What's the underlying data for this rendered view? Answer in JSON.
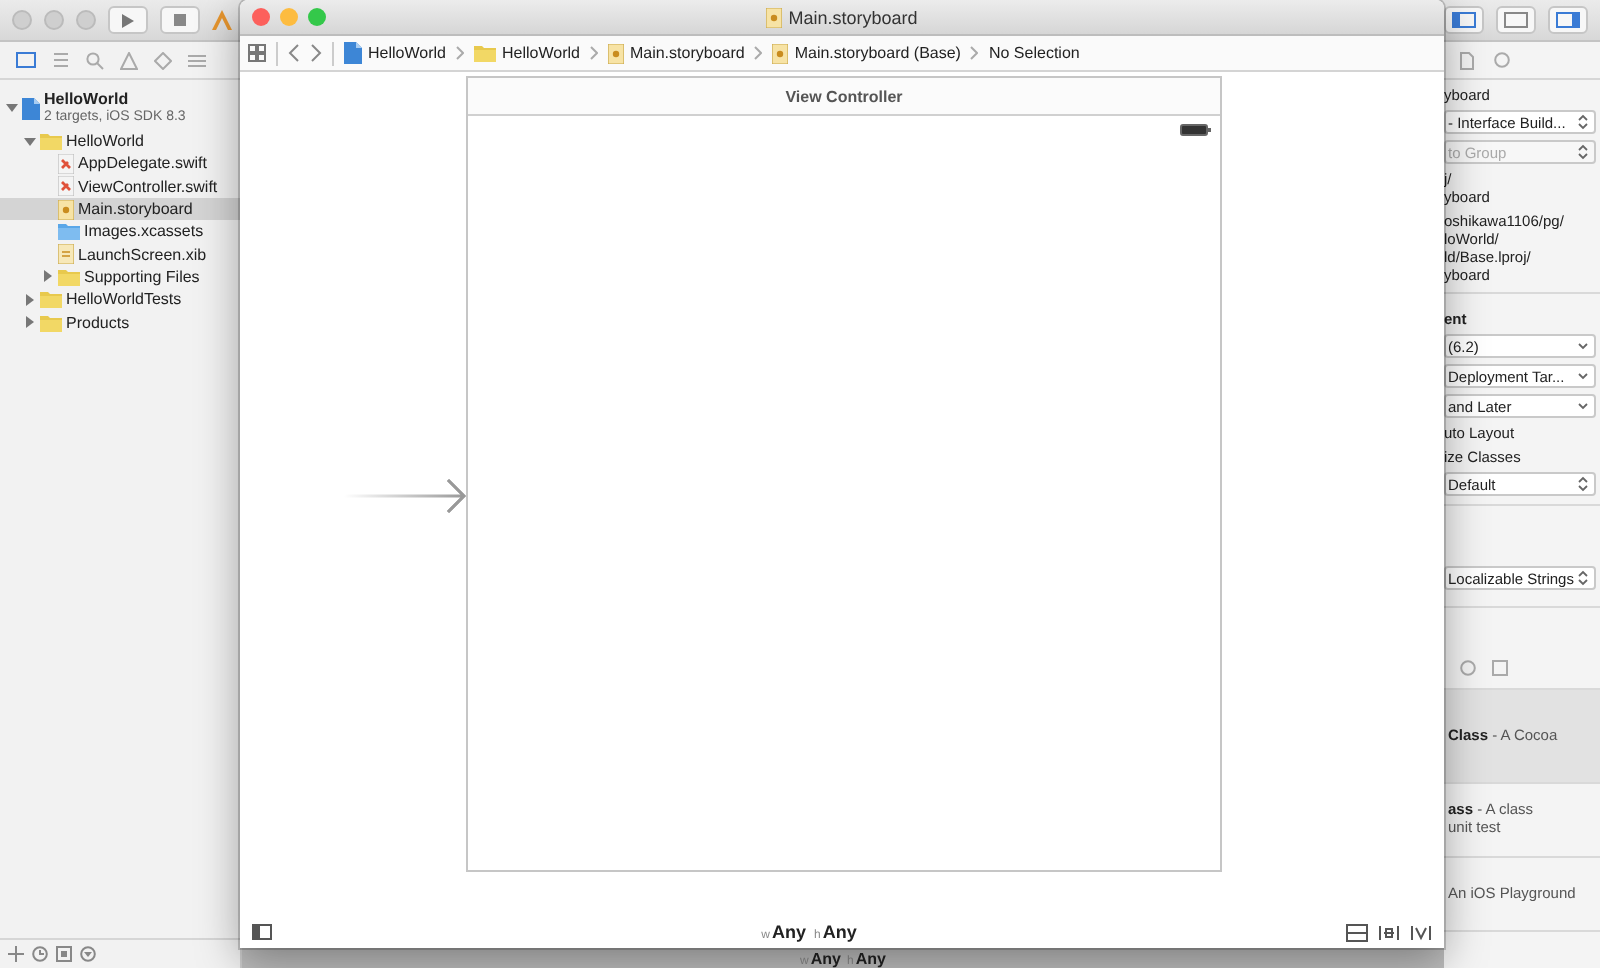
{
  "xcode": {
    "navigator": {
      "tree": [
        {
          "label": "HelloWorld",
          "subtitle": "2 targets, iOS SDK 8.3",
          "kind": "project",
          "expanded": true,
          "selected": false,
          "children": [
            {
              "label": "HelloWorld",
              "kind": "folder",
              "expanded": true,
              "selected": false,
              "children": [
                {
                  "label": "AppDelegate.swift",
                  "kind": "swift",
                  "selected": false
                },
                {
                  "label": "ViewController.swift",
                  "kind": "swift",
                  "selected": false
                },
                {
                  "label": "Main.storyboard",
                  "kind": "storyboard",
                  "selected": true
                },
                {
                  "label": "Images.xcassets",
                  "kind": "assets",
                  "selected": false
                },
                {
                  "label": "LaunchScreen.xib",
                  "kind": "xib",
                  "selected": false
                },
                {
                  "label": "Supporting Files",
                  "kind": "folder",
                  "expanded": false,
                  "selected": false
                }
              ]
            },
            {
              "label": "HelloWorldTests",
              "kind": "folder",
              "expanded": false,
              "selected": false
            },
            {
              "label": "Products",
              "kind": "folder",
              "expanded": false,
              "selected": false
            }
          ]
        }
      ]
    },
    "inspector": {
      "identity": {
        "name_tail": "yboard",
        "type": {
          "value": "- Interface Build...",
          "kind": "popup",
          "disabled": false
        },
        "location": {
          "value": "to Group",
          "kind": "popup",
          "disabled": true
        },
        "path_lines": [
          "j/",
          "yboard"
        ],
        "full_path_lines": [
          "oshikawa1106/pg/",
          "loWorld/",
          "ld/Base.lproj/",
          "yboard"
        ]
      },
      "document": {
        "heading": "ent",
        "menus": [
          {
            "value": "(6.2)",
            "kind": "pulldown",
            "disabled": false
          },
          {
            "value": "Deployment Tar...",
            "kind": "pulldown",
            "disabled": false
          },
          {
            "value": "and Later",
            "kind": "pulldown",
            "disabled": false
          }
        ],
        "checks": [
          "uto Layout",
          "ize Classes"
        ],
        "tint": {
          "value": "Default",
          "kind": "popup",
          "disabled": false
        }
      },
      "localization": {
        "value": "Localizable Strings",
        "kind": "popup",
        "disabled": false
      },
      "library": [
        {
          "title": "Class",
          "description": " - A Cocoa",
          "selected": true
        },
        {
          "title": "ass",
          "description": " - A class",
          "line2": "unit test",
          "selected": false
        },
        {
          "description": "An iOS Playground",
          "selected": false
        }
      ]
    },
    "editor_bottom_bar": {
      "size_classes": [
        {
          "prefix": "w",
          "value": "Any"
        },
        {
          "prefix": "h",
          "value": "Any"
        }
      ]
    }
  },
  "storyboard_window": {
    "title": "Main.storyboard",
    "breadcrumbs": [
      {
        "label": "HelloWorld",
        "kind": "project"
      },
      {
        "label": "HelloWorld",
        "kind": "folder"
      },
      {
        "label": "Main.storyboard",
        "kind": "storyboard"
      },
      {
        "label": "Main.storyboard (Base)",
        "kind": "storyboard"
      },
      {
        "label": "No Selection",
        "kind": "none"
      }
    ],
    "scene": {
      "title": "View Controller"
    },
    "size_classes": [
      {
        "prefix": "w",
        "value": "Any"
      },
      {
        "prefix": "h",
        "value": "Any"
      }
    ]
  }
}
